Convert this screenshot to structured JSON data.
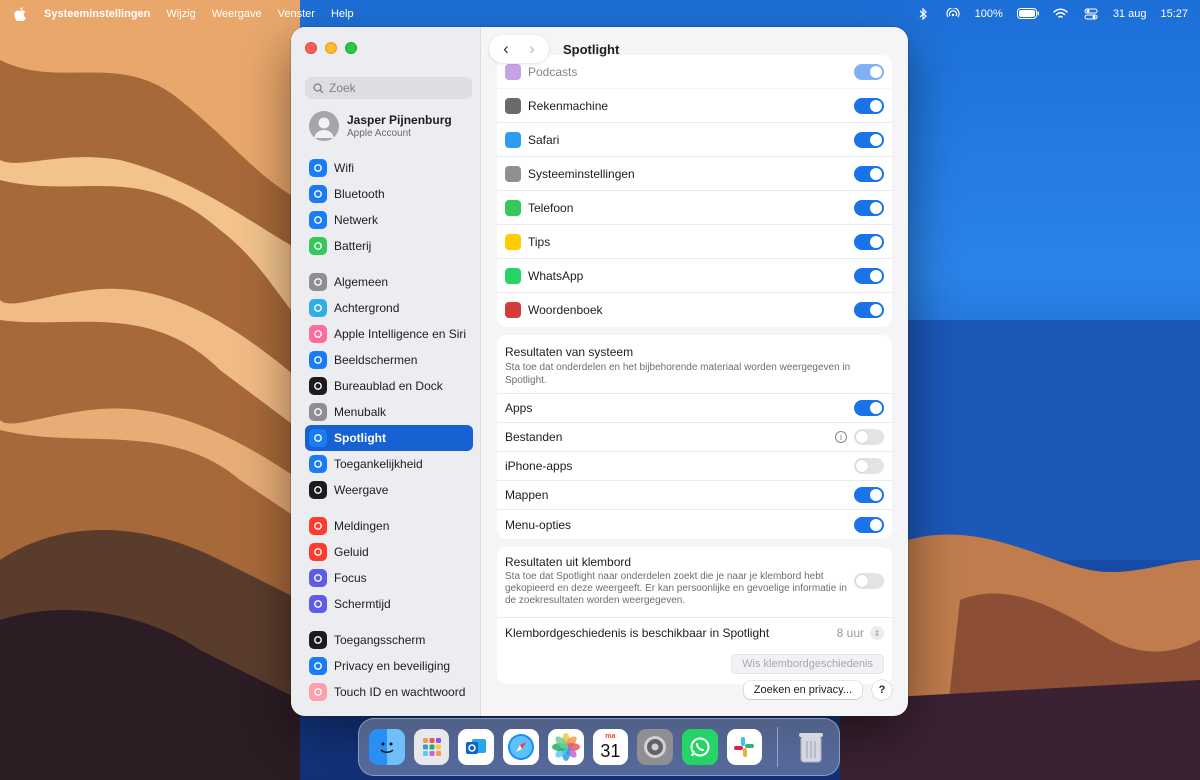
{
  "menubar": {
    "app_name": "Systeeminstellingen",
    "menus": [
      "Wijzig",
      "Weergave",
      "Venster",
      "Help"
    ],
    "battery": "100%",
    "date": "31 aug",
    "time": "15:27"
  },
  "window": {
    "title": "Spotlight"
  },
  "sidebar": {
    "search_placeholder": "Zoek",
    "account_name": "Jasper Pijnenburg",
    "account_sub": "Apple Account",
    "groups": [
      [
        {
          "label": "Wifi",
          "icon": "wifi-icon",
          "color": "#1a7cf5"
        },
        {
          "label": "Bluetooth",
          "icon": "bluetooth-icon",
          "color": "#1a7cf5"
        },
        {
          "label": "Netwerk",
          "icon": "globe-icon",
          "color": "#1a7cf5"
        },
        {
          "label": "Batterij",
          "icon": "battery-icon",
          "color": "#34c759"
        }
      ],
      [
        {
          "label": "Algemeen",
          "icon": "gear-icon",
          "color": "#8e8e93"
        },
        {
          "label": "Achtergrond",
          "icon": "flower-icon",
          "color": "#32ade6"
        },
        {
          "label": "Apple Intelligence en Siri",
          "icon": "siri-icon",
          "color": "#ff6b9a"
        },
        {
          "label": "Beeldschermen",
          "icon": "sun-icon",
          "color": "#1a7cf5"
        },
        {
          "label": "Bureaublad en Dock",
          "icon": "dock-icon",
          "color": "#1c1c1e"
        },
        {
          "label": "Menubalk",
          "icon": "menubar-icon",
          "color": "#8e8e93"
        },
        {
          "label": "Spotlight",
          "icon": "spotlight-icon",
          "color": "#1a7cf5",
          "active": true
        },
        {
          "label": "Toegankelijkheid",
          "icon": "accessibility-icon",
          "color": "#1a7cf5"
        },
        {
          "label": "Weergave",
          "icon": "appearance-icon",
          "color": "#1c1c1e"
        }
      ],
      [
        {
          "label": "Meldingen",
          "icon": "bell-icon",
          "color": "#ff3b30"
        },
        {
          "label": "Geluid",
          "icon": "speaker-icon",
          "color": "#ff3b30"
        },
        {
          "label": "Focus",
          "icon": "moon-icon",
          "color": "#5e5ce6"
        },
        {
          "label": "Schermtijd",
          "icon": "hourglass-icon",
          "color": "#5e5ce6"
        }
      ],
      [
        {
          "label": "Toegangsscherm",
          "icon": "lock-icon",
          "color": "#1c1c1e"
        },
        {
          "label": "Privacy en beveiliging",
          "icon": "hand-icon",
          "color": "#1a7cf5"
        },
        {
          "label": "Touch ID en wachtwoord",
          "icon": "fingerprint-icon",
          "color": "#ff9fae"
        }
      ]
    ]
  },
  "apps": [
    {
      "label": "Podcasts",
      "color": "#9b59d0",
      "on": true,
      "faded": true
    },
    {
      "label": "Rekenmachine",
      "color": "#6b6b6b",
      "on": true
    },
    {
      "label": "Safari",
      "color": "#2d9cf0",
      "on": true
    },
    {
      "label": "Systeeminstellingen",
      "color": "#8e8e93",
      "on": true
    },
    {
      "label": "Telefoon",
      "color": "#34c759",
      "on": true
    },
    {
      "label": "Tips",
      "color": "#ffcc00",
      "on": true
    },
    {
      "label": "WhatsApp",
      "color": "#25d366",
      "on": true
    },
    {
      "label": "Woordenboek",
      "color": "#d63a3a",
      "on": true
    }
  ],
  "system_results": {
    "title": "Resultaten van systeem",
    "description": "Sta toe dat onderdelen en het bijbehorende materiaal worden weergegeven in Spotlight.",
    "items": [
      {
        "label": "Apps",
        "on": true
      },
      {
        "label": "Bestanden",
        "on": false,
        "info": true
      },
      {
        "label": "iPhone-apps",
        "on": false
      },
      {
        "label": "Mappen",
        "on": true
      },
      {
        "label": "Menu-opties",
        "on": true
      }
    ]
  },
  "clipboard": {
    "title": "Resultaten uit klembord",
    "description": "Sta toe dat Spotlight naar onderdelen zoekt die je naar je klembord hebt gekopieerd en deze weergeeft. Er kan persoonlijke en gevoelige informatie in de zoekresultaten worden weergegeven.",
    "on": false,
    "history_label": "Klembordgeschiedenis is beschikbaar in Spotlight",
    "history_value": "8 uur",
    "clear_button": "Wis klembordgeschiedenis"
  },
  "footer": {
    "privacy_button": "Zoeken en privacy...",
    "help": "?"
  },
  "dock": {
    "calendar_month": "ma",
    "calendar_day": "31"
  }
}
